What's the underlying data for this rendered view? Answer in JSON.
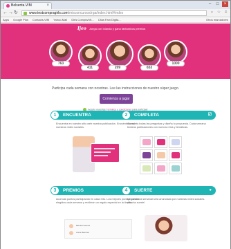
{
  "browser": {
    "tab_title": "Belsenta.VIM",
    "url_host": "www.testcompragirls.com",
    "url_path": "/misconcursos/rga/index.html#index",
    "bookmarks": [
      "Apps",
      "Google Plus",
      "Contacts-VIM",
      "Yahoo-Mail",
      "Girls Compra/Vit...",
      "Citas Fam Digita...",
      "Otros marcadores"
    ]
  },
  "hero": {
    "logo": "Ijeo",
    "banner_text": "Juega con Iolanda y gana fantásticos premios",
    "winners": [
      {
        "score": "763"
      },
      {
        "score": "411"
      },
      {
        "score": "209"
      },
      {
        "score": "653"
      },
      {
        "score": "1000"
      }
    ]
  },
  "intro": {
    "tagline": "Participa cada semana con nosotras. Lee las instrucciones de nuestro súper juego.",
    "cta_label": "Comienza a jugar",
    "terms_prefix": "Acepto nuestras",
    "terms_link": "Términos y condiciones",
    "terms_suffix": "para participar"
  },
  "steps": [
    {
      "number": "1",
      "title": "ENCUENTRA",
      "icon": "search-icon",
      "description": "Encuentra en nuestro sitio web nuestra publicación. Encuéntralo en nuestras redes sociales."
    },
    {
      "number": "2",
      "title": "COMPLETA",
      "icon": "checkbox-icon",
      "description": "Completa todas las preguntas y diseña tu propuesta. Cada semana tendrás publicaciones con nuevos retos y temáticas."
    },
    {
      "number": "3",
      "title": "PREMIOS",
      "icon": "trophy-icon",
      "description": "Acumula puntos participando en cada reto. Los mejores puntajes serán elegidos cada semana y recibirán un regalo especial en la tienda."
    },
    {
      "number": "4",
      "title": "SUERTE",
      "icon": "drop-icon",
      "description": "La ganadora semanal será anunciada por nuestras redes sociales. ¡Mucha suerte!"
    }
  ],
  "prize_list": [
    "Mónica Gómez",
    "Anna Ramírez"
  ],
  "colors": {
    "pink": "#e2317c",
    "teal": "#1fb5b5",
    "purple": "#7d4398"
  }
}
